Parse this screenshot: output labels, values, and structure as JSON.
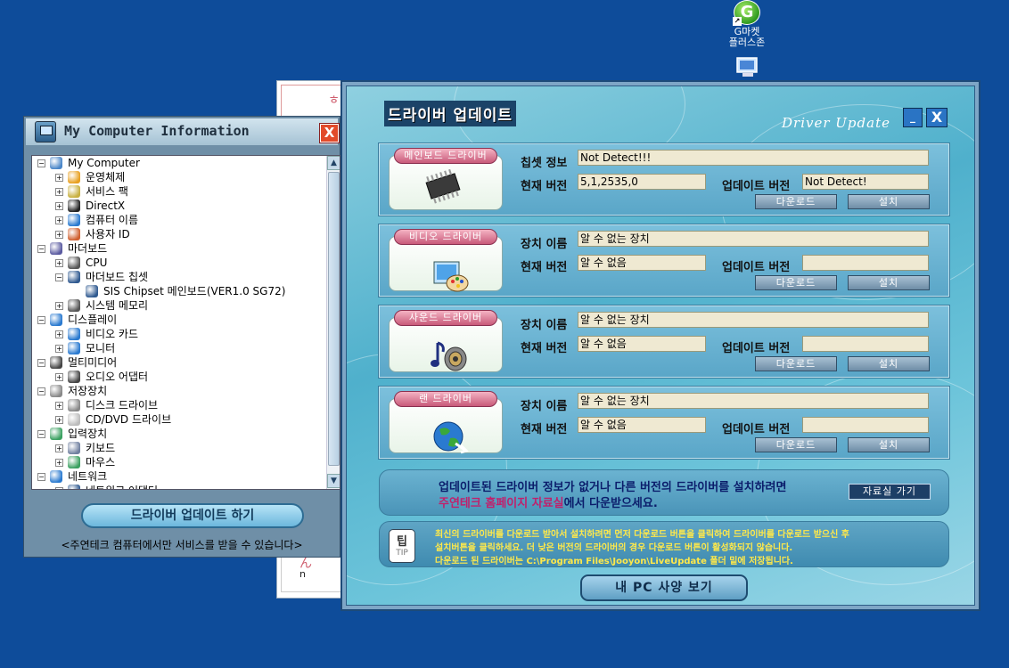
{
  "desktop": {
    "icon1_label_line1": "G마켓",
    "icon1_label_line2": "플러스존",
    "icon1_glyph": "G"
  },
  "bg_window": {
    "char_top": "ㅎ",
    "char_bottom1": "ん",
    "char_bottom2": "n"
  },
  "mci": {
    "title": "My Computer Information",
    "close": "X",
    "tree": [
      {
        "label": "My Computer",
        "level": 0,
        "toggle": "⊟",
        "icon": "computer"
      },
      {
        "label": "운영체제",
        "level": 1,
        "toggle": "⊞",
        "icon": "windows"
      },
      {
        "label": "서비스 팩",
        "level": 1,
        "toggle": "⊞",
        "icon": "pack"
      },
      {
        "label": "DirectX",
        "level": 1,
        "toggle": "⊞",
        "icon": "directx"
      },
      {
        "label": "컴퓨터 이름",
        "level": 1,
        "toggle": "⊞",
        "icon": "globe"
      },
      {
        "label": "사용자 ID",
        "level": 1,
        "toggle": "⊞",
        "icon": "users"
      },
      {
        "label": "마더보드",
        "level": 0,
        "toggle": "⊟",
        "icon": "board"
      },
      {
        "label": "CPU",
        "level": 1,
        "toggle": "⊞",
        "icon": "chip"
      },
      {
        "label": "마더보드 칩셋",
        "level": 1,
        "toggle": "⊟",
        "icon": "pc"
      },
      {
        "label": "SIS Chipset 메인보드(VER1.0 SG72)",
        "level": 2,
        "toggle": "",
        "icon": "pc"
      },
      {
        "label": "시스템 메모리",
        "level": 1,
        "toggle": "⊞",
        "icon": "chip"
      },
      {
        "label": "디스플레이",
        "level": 0,
        "toggle": "⊟",
        "icon": "globe"
      },
      {
        "label": "비디오 카드",
        "level": 1,
        "toggle": "⊞",
        "icon": "globe"
      },
      {
        "label": "모니터",
        "level": 1,
        "toggle": "⊞",
        "icon": "globe"
      },
      {
        "label": "멀티미디어",
        "level": 0,
        "toggle": "⊟",
        "icon": "speaker"
      },
      {
        "label": "오디오 어댑터",
        "level": 1,
        "toggle": "⊞",
        "icon": "speaker"
      },
      {
        "label": "저장장치",
        "level": 0,
        "toggle": "⊟",
        "icon": "disk"
      },
      {
        "label": "디스크 드라이브",
        "level": 1,
        "toggle": "⊞",
        "icon": "disk"
      },
      {
        "label": "CD/DVD 드라이브",
        "level": 1,
        "toggle": "⊞",
        "icon": "cd"
      },
      {
        "label": "입력장치",
        "level": 0,
        "toggle": "⊟",
        "icon": "mouse"
      },
      {
        "label": "키보드",
        "level": 1,
        "toggle": "⊞",
        "icon": "keyboard"
      },
      {
        "label": "마우스",
        "level": 1,
        "toggle": "⊞",
        "icon": "mouse"
      },
      {
        "label": "네트워크",
        "level": 0,
        "toggle": "⊟",
        "icon": "globe"
      },
      {
        "label": "네트워크 어댑터",
        "level": 1,
        "toggle": "⊞",
        "icon": "pc"
      }
    ],
    "update_button": "드라이버 업데이트 하기",
    "footer": "<주연테크 컴퓨터에서만 서비스를 받을 수 있습니다>"
  },
  "du": {
    "title": "드라이버 업데이트",
    "subtitle": "Driver Update",
    "min": "_",
    "close": "X",
    "panels": [
      {
        "tag": "메인보드 드라이버",
        "label1": "칩셋 정보",
        "value1": "Not Detect!!!",
        "label2": "현재 버전",
        "value2": "5,1,2535,0",
        "label3": "업데이트 버전",
        "value3": "Not Detect!",
        "download": "다운로드",
        "install": "설치",
        "icon": "chip-icon"
      },
      {
        "tag": "비디오 드라이버",
        "label1": "장치 이름",
        "value1": "알 수 없는 장치",
        "label2": "현재 버전",
        "value2": "알 수 없음",
        "label3": "업데이트 버전",
        "value3": "",
        "download": "다운로드",
        "install": "설치",
        "icon": "palette-icon"
      },
      {
        "tag": "사운드 드라이버",
        "label1": "장치 이름",
        "value1": "알 수 없는 장치",
        "label2": "현재 버전",
        "value2": "알 수 없음",
        "label3": "업데이트 버전",
        "value3": "",
        "download": "다운로드",
        "install": "설치",
        "icon": "music-speaker-icon"
      },
      {
        "tag": "랜 드라이버",
        "label1": "장치 이름",
        "value1": "알 수 없는 장치",
        "label2": "현재 버전",
        "value2": "알 수 없음",
        "label3": "업데이트 버전",
        "value3": "",
        "download": "다운로드",
        "install": "설치",
        "icon": "network-globe-icon"
      }
    ],
    "notice": {
      "line1": "업데이트된 드라이버 정보가 없거나 다른 버전의 드라이버를 설치하려면",
      "line2_highlight": "주연테크 홈페이지 자료실",
      "line2_rest": "에서 다운받으세요.",
      "button": "자료실 가기"
    },
    "tip": {
      "icon_top": "팁",
      "icon_bottom": "TIP",
      "line1": "최신의 드라이버를 다운로드 받아서 설치하려면 먼저 다운로드 버튼을 클릭하여 드라이버를 다운로드 받으신 후",
      "line2": "설치버튼을 클릭하세요. 더 낮은 버전의 드라이버의 경우 다운로드 버튼이 활성화되지 않습니다.",
      "line3": "다운로드 된 드라이버는 C:\\Program Files\\Jooyon\\LiveUpdate 폴더 밑에 저장됩니다."
    },
    "spec_button": "내 PC 사양 보기"
  }
}
